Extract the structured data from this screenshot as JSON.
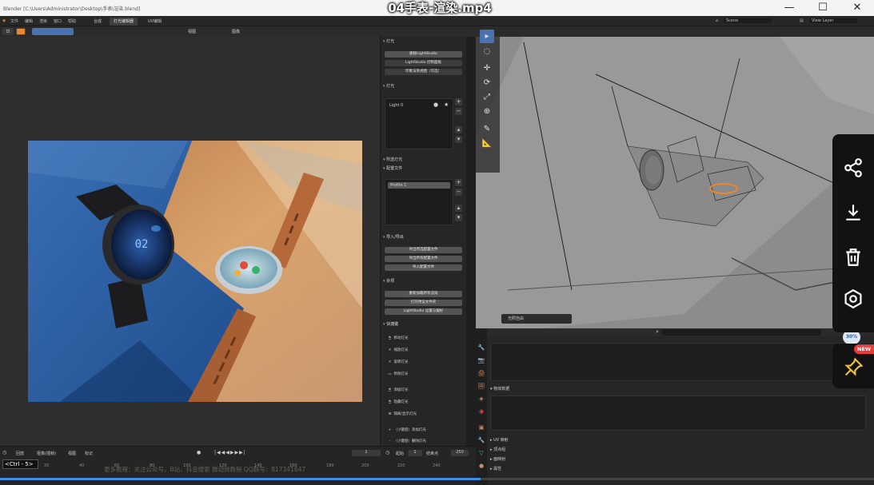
{
  "window": {
    "path": "Blender [C:\\Users\\Administrator\\Desktop\\手表\\渲染.blend]",
    "video_title": "04手表-渲染.mp4",
    "min": "—",
    "max": "☐",
    "close": "✕"
  },
  "menubar": {
    "items": [
      "文件",
      "编辑",
      "渲染",
      "窗口",
      "帮助"
    ],
    "workspace_tabs": [
      "合成",
      "灯光编辑器",
      "UV编辑"
    ],
    "active_tab": 1,
    "scene": "Scene",
    "view_layer": "View Layer"
  },
  "left_header": {
    "view": "视图",
    "slot": "图像"
  },
  "npanel": {
    "tab_label": "灯光",
    "sections": {
      "light": "灯光",
      "lights": "灯光",
      "selected": "所选灯光",
      "profiles": "配置文件",
      "import_export": "导入/导出",
      "misc": "杂项",
      "shortcuts": "快捷键"
    },
    "buttons_top": [
      "删除LightStudio",
      "LightStudio 控制面板",
      "印象渲染视图（可选）"
    ],
    "light_item": "Light 0",
    "profile_item": "Profile 1",
    "buttons_io": [
      "导出所选配置文件",
      "导出所有配置文件",
      "导入配置文件"
    ],
    "buttons_misc": [
      "重新加载所有渲染",
      "打开预设文件夹",
      "LightStudio 设置与偏好"
    ],
    "shortcuts": [
      {
        "icon": "🖱",
        "label": "移动灯光"
      },
      {
        "icon": "✕",
        "label": "缩放灯光"
      },
      {
        "icon": "✕",
        "label": "旋转灯光"
      },
      {
        "icon": "▭",
        "label": "移除灯光"
      },
      {
        "icon": "🖱",
        "label": "添加灯光"
      },
      {
        "icon": "🖱",
        "label": "隐藏灯光"
      },
      {
        "icon": "⊞",
        "label": "隔离/显示灯光"
      },
      {
        "icon": "+",
        "label": "（小键盘）添加灯光"
      },
      {
        "icon": "-",
        "label": "（小键盘）删除灯光"
      }
    ]
  },
  "viewport": {
    "status": "光照自由",
    "tools": [
      "▸",
      "◌",
      "✛",
      "⟳",
      "⤢",
      "⊕",
      "✎",
      "📐"
    ]
  },
  "lower_right": {
    "sections": [
      "物体数据",
      "UV 映射",
      "顶点组",
      "面映射",
      "属性"
    ],
    "zoom": "30%"
  },
  "timeline": {
    "menu": [
      "回放",
      "抠像(插帧)",
      "视图",
      "标记"
    ],
    "ticks": [
      "20",
      "40",
      "60",
      "80",
      "100",
      "120",
      "140",
      "160",
      "180",
      "200",
      "220",
      "240"
    ],
    "frame": "1",
    "start_label": "起始",
    "start": "1",
    "end_label": "结束点",
    "end": "250"
  },
  "overlay": {
    "ctrl_hint": "<Ctrl - 5>",
    "subtitle": "更多教程：关注公众号，B站，抖音搜索 微动效教程    QQ群号：817341647",
    "progress": 0.55
  },
  "share_bar": {
    "icons": [
      "share-icon",
      "download-icon",
      "delete-icon",
      "settings-icon"
    ],
    "badge": "NEW"
  },
  "colors": {
    "accent": "#3a8ee6",
    "badge": "#e83b3b",
    "selection": "#e8872b"
  }
}
